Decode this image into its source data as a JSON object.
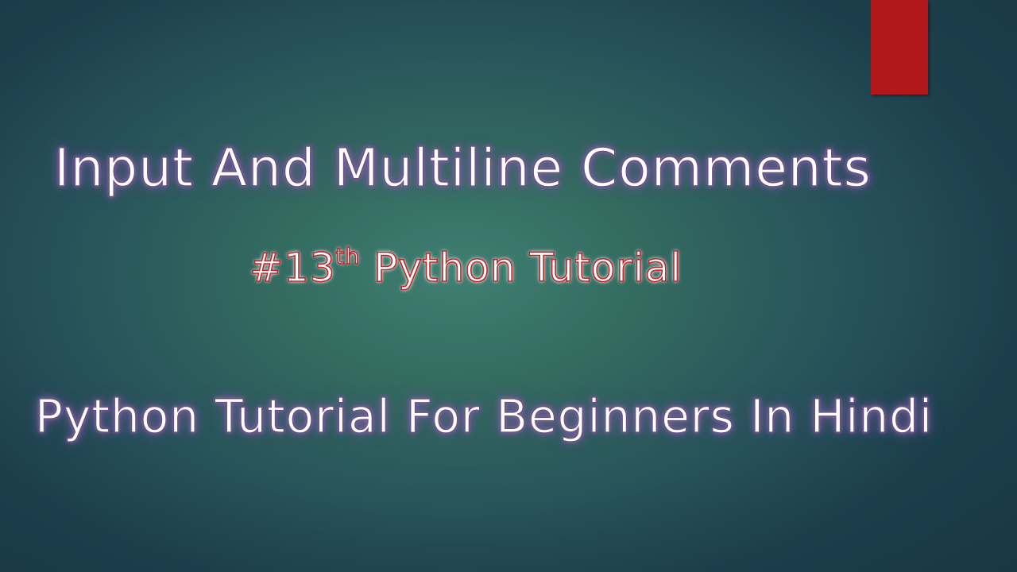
{
  "slide": {
    "title": "Input And Multiline Comments",
    "subtitle": {
      "prefix": "#13",
      "superscript": "th",
      "suffix": " Python Tutorial"
    },
    "tagline": "Python Tutorial For Beginners In Hindi"
  },
  "colors": {
    "background_center": "#3f7f72",
    "background_edge": "#1f4350",
    "accent_bar": "#b0181a",
    "title_glow": "#7c5fa0",
    "subtitle_outline": "#c0272b",
    "text_fill": "#ffffff"
  }
}
